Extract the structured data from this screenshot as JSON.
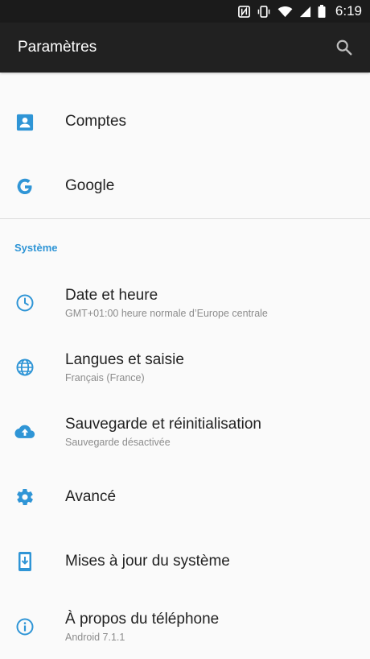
{
  "status_bar": {
    "time": "6:19",
    "icons": [
      "nfc-icon",
      "vibrate-icon",
      "wifi-icon",
      "signal-icon",
      "battery-icon"
    ]
  },
  "app_bar": {
    "title": "Paramètres",
    "search_icon": "search-icon"
  },
  "accent_color": "#2f95d6",
  "top_items": [
    {
      "label": "Comptes",
      "icon": "account-icon"
    },
    {
      "label": "Google",
      "icon": "google-icon"
    }
  ],
  "section": {
    "title": "Système"
  },
  "system_items": [
    {
      "label": "Date et heure",
      "sub": "GMT+01:00 heure normale d’Europe centrale",
      "icon": "clock-icon"
    },
    {
      "label": "Langues et saisie",
      "sub": "Français (France)",
      "icon": "globe-icon"
    },
    {
      "label": "Sauvegarde et réinitialisation",
      "sub": "Sauvegarde désactivée",
      "icon": "cloud-upload-icon"
    },
    {
      "label": "Avancé",
      "icon": "gear-icon"
    },
    {
      "label": "Mises à jour du système",
      "icon": "system-update-icon"
    },
    {
      "label": "À propos du téléphone",
      "sub": "Android 7.1.1",
      "icon": "info-icon"
    }
  ]
}
